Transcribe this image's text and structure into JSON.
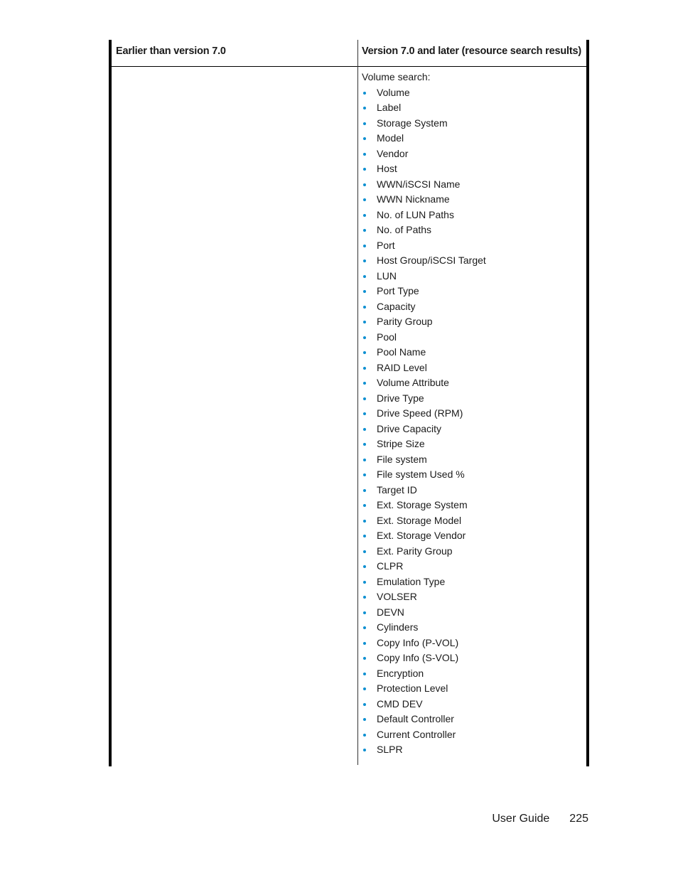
{
  "table": {
    "headers": {
      "left": "Earlier than version 7.0",
      "right": "Version 7.0 and later (resource search results)"
    },
    "rows": [
      {
        "left": "",
        "right": {
          "intro": "Volume search:",
          "items": [
            "Volume",
            "Label",
            "Storage System",
            "Model",
            "Vendor",
            "Host",
            "WWN/iSCSI Name",
            "WWN Nickname",
            "No. of LUN Paths",
            "No. of Paths",
            "Port",
            "Host Group/iSCSI Target",
            "LUN",
            "Port Type",
            "Capacity",
            "Parity Group",
            "Pool",
            "Pool Name",
            "RAID Level",
            "Volume Attribute",
            "Drive Type",
            "Drive Speed (RPM)",
            "Drive Capacity",
            "Stripe Size",
            "File system",
            "File system Used %",
            "Target ID",
            "Ext. Storage System",
            "Ext. Storage Model",
            "Ext. Storage Vendor",
            "Ext. Parity Group",
            "CLPR",
            "Emulation Type",
            "VOLSER",
            "DEVN",
            "Cylinders",
            "Copy Info (P-VOL)",
            "Copy Info (S-VOL)",
            "Encryption",
            "Protection Level",
            "CMD DEV",
            "Default Controller",
            "Current Controller",
            "SLPR"
          ]
        }
      }
    ]
  },
  "footer": {
    "doc_title": "User Guide",
    "page_number": "225"
  },
  "colors": {
    "bullet": "#0b8fd1",
    "text": "#1a1a1a",
    "border": "#000000"
  }
}
